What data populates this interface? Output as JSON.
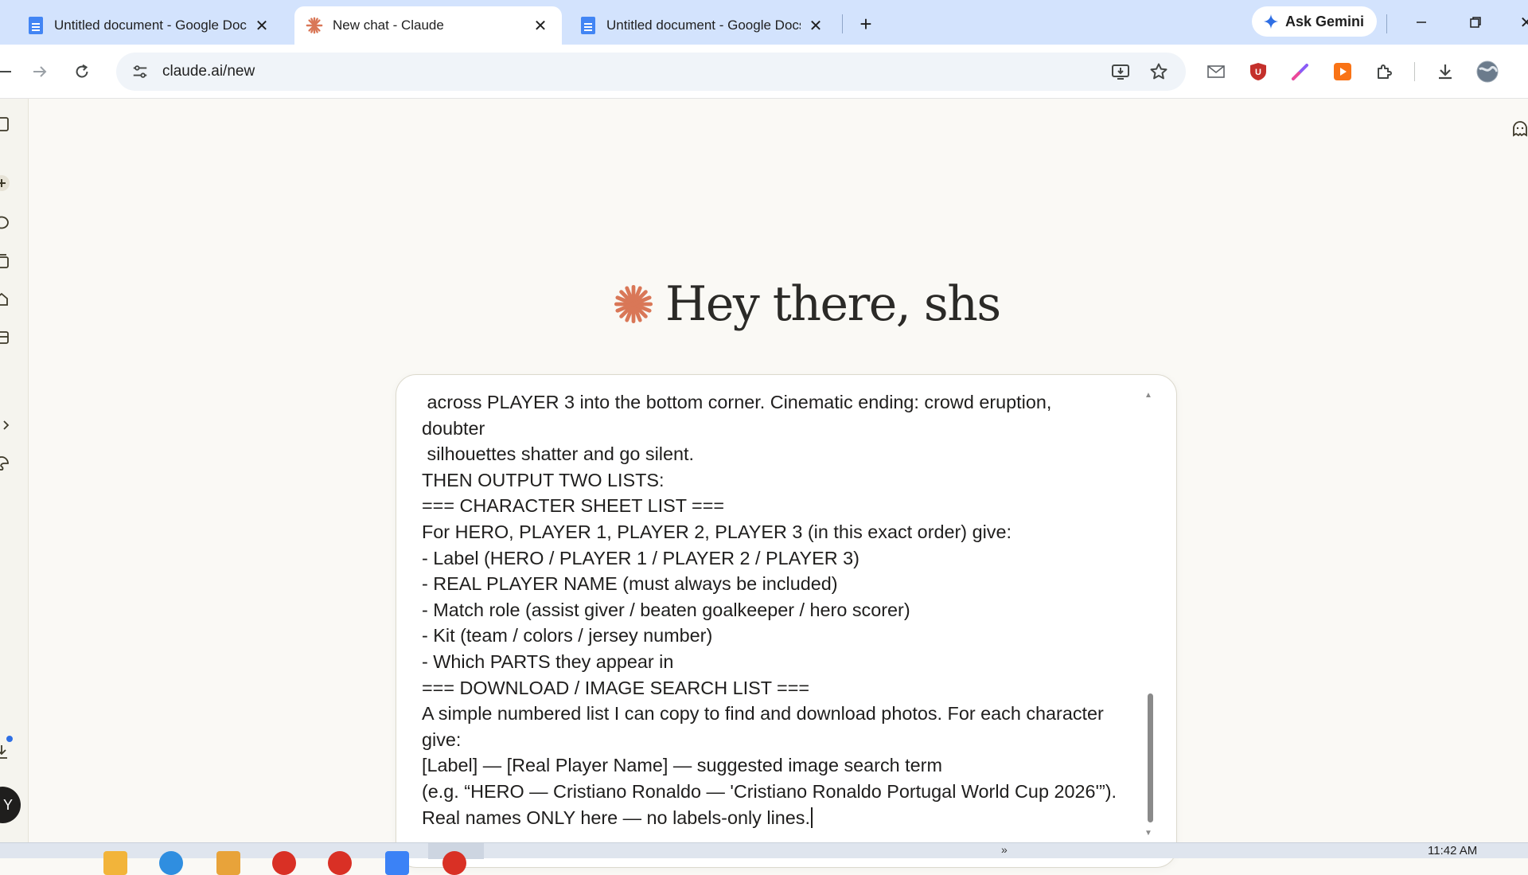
{
  "browser": {
    "tabs": [
      {
        "title": "Untitled document - Google Docs",
        "favicon": "google-docs-icon",
        "active": false
      },
      {
        "title": "New chat - Claude",
        "favicon": "claude-icon",
        "active": true
      },
      {
        "title": "Untitled document - Google Docs",
        "favicon": "google-docs-icon",
        "active": false
      }
    ],
    "gemini_label": "Ask Gemini",
    "url": "claude.ai/new"
  },
  "page": {
    "greeting": "Hey there, shs",
    "prompt_text": " across PLAYER 3 into the bottom corner. Cinematic ending: crowd eruption,\ndoubter\n silhouettes shatter and go silent.\nTHEN OUTPUT TWO LISTS:\n=== CHARACTER SHEET LIST ===\nFor HERO, PLAYER 1, PLAYER 2, PLAYER 3 (in this exact order) give:\n- Label (HERO / PLAYER 1 / PLAYER 2 / PLAYER 3)\n- REAL PLAYER NAME (must always be included)\n- Match role (assist giver / beaten goalkeeper / hero scorer)\n- Kit (team / colors / jersey number)\n- Which PARTS they appear in\n=== DOWNLOAD / IMAGE SEARCH LIST ===\nA simple numbered list I can copy to find and download photos. For each character\ngive:\n[Label] — [Real Player Name] — suggested image search term\n(e.g. “HERO — Cristiano Ronaldo — 'Cristiano Ronaldo Portugal World Cup 2026'”).\nReal names ONLY here — no labels-only lines.",
    "avatar_letter": "Y"
  },
  "taskbar": {
    "clock": "11:42 AM"
  },
  "colors": {
    "claude_accent": "#d97757",
    "tab_strip": "#d3e3fd",
    "page_bg": "#faf9f5"
  }
}
